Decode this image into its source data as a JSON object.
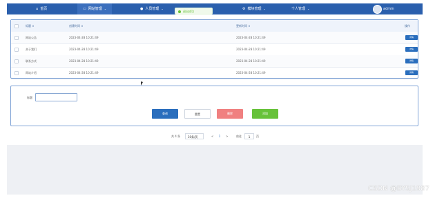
{
  "nav": {
    "home": "首页",
    "site_mgmt": "网站管理",
    "user_mgmt": "人员管理",
    "module_mgmt": "模块管理",
    "personal_mgmt": "个人管理",
    "admin_name": "admin",
    "caret": "⌄"
  },
  "toast": {
    "message": "退出成功"
  },
  "table": {
    "col_title": "标题 ⇕",
    "col_created": "创建时间 ⇕",
    "col_updated": "更新时间 ⇕",
    "col_action": "操作",
    "detail_label": "详情",
    "rows": [
      {
        "title": "网站公告",
        "created": "2023-04-28 10:21:49",
        "updated": "2023-04-28 10:21:49"
      },
      {
        "title": "关于我们",
        "created": "2023-04-28 10:21:49",
        "updated": "2023-04-28 10:21:49"
      },
      {
        "title": "联系方式",
        "created": "2023-04-28 10:21:49",
        "updated": "2023-04-28 10:21:49"
      },
      {
        "title": "网站介绍",
        "created": "2023-04-28 10:21:49",
        "updated": "2023-04-28 10:21:49"
      }
    ]
  },
  "search": {
    "label": "标题",
    "value": "",
    "query_btn": "查询",
    "reset_btn": "重置",
    "delete_btn": "删除",
    "add_btn": "添加"
  },
  "pagination": {
    "total": "共 4 条",
    "page_size": "10条/页",
    "prev": "<",
    "current": "1",
    "next": ">",
    "goto_label": "前往",
    "goto_value": "1",
    "goto_suffix": "页"
  },
  "watermark": "CSDN @BYSJ1987",
  "colors": {
    "nav": "#2a5fad",
    "primary": "#2a6ebd",
    "danger": "#f08080",
    "success": "#67c23a"
  }
}
